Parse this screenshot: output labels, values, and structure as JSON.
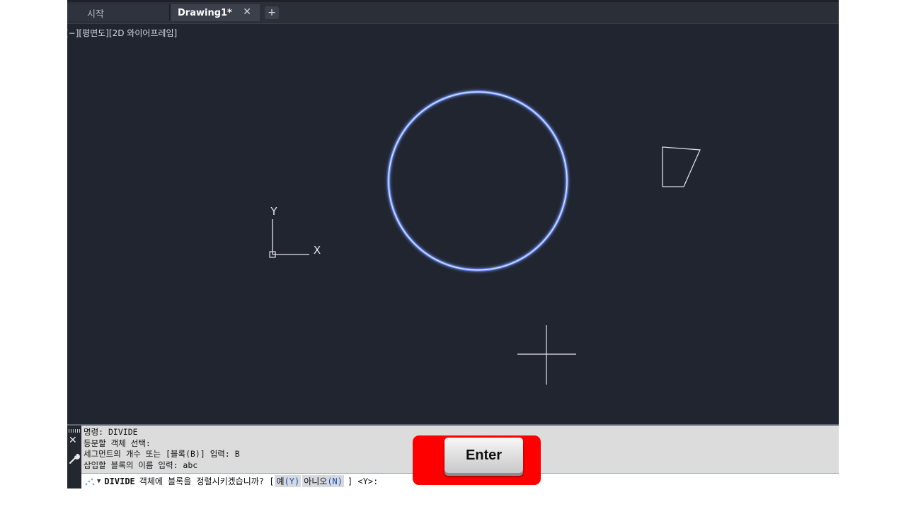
{
  "tabs": [
    {
      "label": "시작"
    },
    {
      "label": "Drawing1*",
      "close": "✕"
    }
  ],
  "tab_add_icon": "+",
  "viewport_label": "[−][평면도][2D 와이어프레임]",
  "ucs": {
    "x_label": "X",
    "y_label": "Y"
  },
  "command_history": [
    "명령: DIVIDE",
    "등분할 객체 선택:",
    "세그먼트의 개수 또는 [블록(B)] 입력: B",
    "삽입할 블록의 이름 입력: abc"
  ],
  "prompt": {
    "command": "DIVIDE",
    "text": "객체에 블록을 정렬시키겠습니까? [",
    "option_yes": "예",
    "option_yes_key": "(Y)",
    "option_no": "아니오",
    "option_no_key": "(N)",
    "suffix": "] <Y>:"
  },
  "key_overlay": {
    "label": "Enter"
  },
  "colors": {
    "canvas": "#21252f",
    "circle": "#a9c4ff",
    "overlay": "#ff0000"
  }
}
